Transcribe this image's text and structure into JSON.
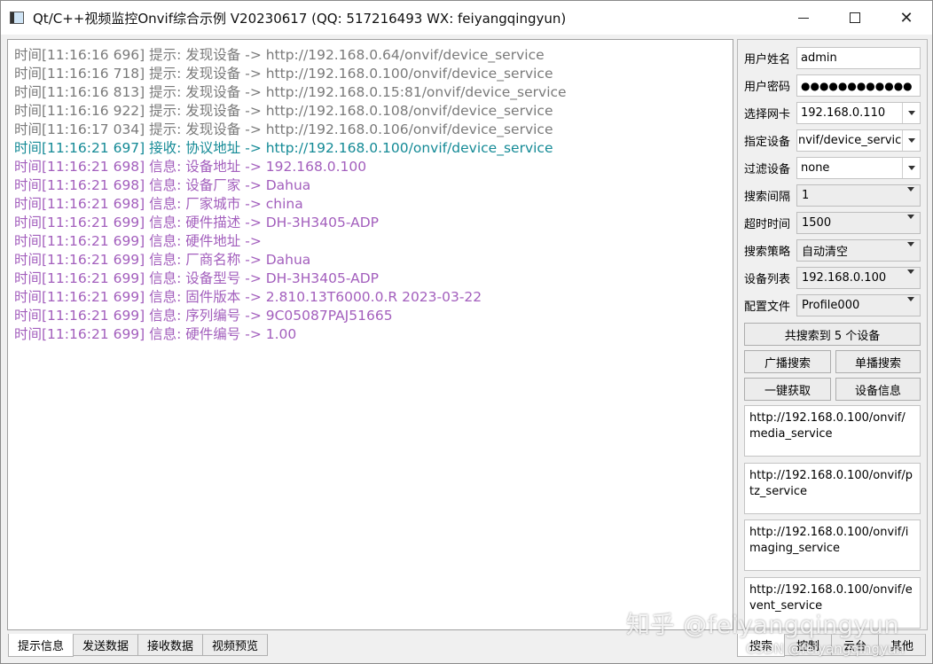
{
  "window": {
    "title": "Qt/C++视频监控Onvif综合示例 V20230617 (QQ: 517216493 WX: feiyangqingyun)",
    "minimize_glyph": "minimize-icon",
    "maximize_glyph": "maximize-icon",
    "close_glyph": "✕"
  },
  "log": {
    "lines": [
      {
        "text": "时间[11:16:16 696] 提示: 发现设备 -> http://192.168.0.64/onvif/device_service",
        "color": "gray"
      },
      {
        "text": "时间[11:16:16 718] 提示: 发现设备 -> http://192.168.0.100/onvif/device_service",
        "color": "gray"
      },
      {
        "text": "时间[11:16:16 813] 提示: 发现设备 -> http://192.168.0.15:81/onvif/device_service",
        "color": "gray"
      },
      {
        "text": "时间[11:16:16 922] 提示: 发现设备 -> http://192.168.0.108/onvif/device_service",
        "color": "gray"
      },
      {
        "text": "时间[11:16:17 034] 提示: 发现设备 -> http://192.168.0.106/onvif/device_service",
        "color": "gray"
      },
      {
        "text": "时间[11:16:21 697] 接收: 协议地址 -> http://192.168.0.100/onvif/device_service",
        "color": "teal"
      },
      {
        "text": "时间[11:16:21 698] 信息: 设备地址 -> 192.168.0.100",
        "color": "purple"
      },
      {
        "text": "时间[11:16:21 698] 信息: 设备厂家 -> Dahua",
        "color": "purple"
      },
      {
        "text": "时间[11:16:21 698] 信息: 厂家城市 -> china",
        "color": "purple"
      },
      {
        "text": "时间[11:16:21 699] 信息: 硬件描述 -> DH-3H3405-ADP",
        "color": "purple"
      },
      {
        "text": "时间[11:16:21 699] 信息: 硬件地址 ->",
        "color": "purple"
      },
      {
        "text": "时间[11:16:21 699] 信息: 厂商名称 -> Dahua",
        "color": "purple"
      },
      {
        "text": "时间[11:16:21 699] 信息: 设备型号 -> DH-3H3405-ADP",
        "color": "purple"
      },
      {
        "text": "时间[11:16:21 699] 信息: 固件版本 -> 2.810.13T6000.0.R 2023-03-22",
        "color": "purple"
      },
      {
        "text": "时间[11:16:21 699] 信息: 序列编号 -> 9C05087PAJ51665",
        "color": "purple"
      },
      {
        "text": "时间[11:16:21 699] 信息: 硬件编号 -> 1.00",
        "color": "purple"
      }
    ]
  },
  "colors": {
    "gray": "#7a7a7a",
    "teal": "#148a96",
    "purple": "#a35fbd"
  },
  "form": {
    "username_label": "用户姓名",
    "username_value": "admin",
    "password_label": "用户密码",
    "password_value": "●●●●●●●●●●●●",
    "nic_label": "选择网卡",
    "nic_value": "192.168.0.110",
    "device_label": "指定设备",
    "device_value": "nvif/device_service",
    "filter_label": "过滤设备",
    "filter_value": "none",
    "interval_label": "搜索间隔",
    "interval_value": "1",
    "timeout_label": "超时时间",
    "timeout_value": "1500",
    "strategy_label": "搜索策略",
    "strategy_value": "自动清空",
    "devlist_label": "设备列表",
    "devlist_value": "192.168.0.100",
    "profile_label": "配置文件",
    "profile_value": "Profile000"
  },
  "buttons": {
    "search_count": "共搜索到 5 个设备",
    "broadcast": "广播搜索",
    "unicast": "单播搜索",
    "one_click": "一键获取",
    "device_info": "设备信息"
  },
  "services": {
    "media": "http://192.168.0.100/onvif/media_service",
    "ptz": "http://192.168.0.100/onvif/ptz_service",
    "imaging": "http://192.168.0.100/onvif/imaging_service",
    "event": "http://192.168.0.100/onvif/event_service"
  },
  "tabs_left": [
    "提示信息",
    "发送数据",
    "接收数据",
    "视频预览"
  ],
  "tabs_right": [
    "搜索",
    "控制",
    "云台",
    "其他"
  ],
  "watermark": {
    "main": "知乎 @feiyangqingyun",
    "sub": "CSDN @feiyangqingyun"
  }
}
